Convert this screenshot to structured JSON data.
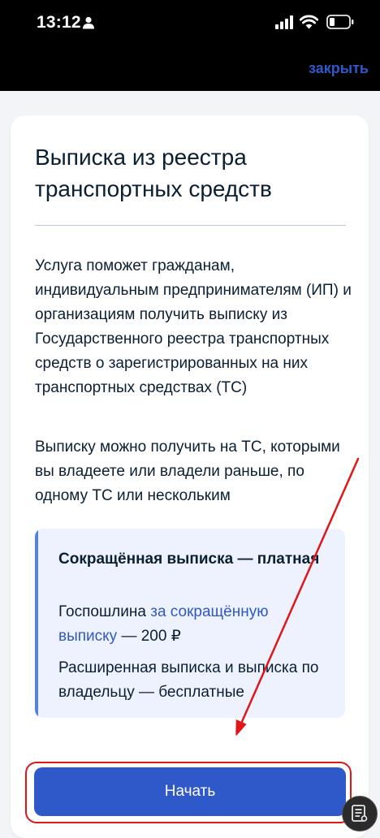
{
  "status_bar": {
    "time": "13:12"
  },
  "header": {
    "close_label": "закрыть"
  },
  "card": {
    "title": "Выписка из реестра транспортных средств",
    "description_1": "Услуга поможет гражданам, индивидуальным предпринимателям (ИП) и организациям получить выписку из Государственного реестра транспортных средств о зарегистрированных на них транспортных средствах (ТС)",
    "description_2": "Выписку можно получить на ТС, которыми вы владеете или владели раньше, по одному ТС или нескольким",
    "info_box": {
      "title": "Сокращённая выписка — платная",
      "fee_prefix": "Госпошлина ",
      "fee_link": "за сокращённую выписку",
      "fee_suffix": " — 200 ₽",
      "free_note": "Расширенная выписка и выписка по владельцу — бесплатные"
    },
    "start_button_label": "Начать"
  },
  "colors": {
    "primary": "#2f58c9",
    "annotation": "#e0161b",
    "text": "#0b1f33",
    "info_bg": "#edf2fe",
    "info_accent": "#5080e8"
  },
  "icons": [
    "person-icon",
    "signal-icon",
    "wifi-icon",
    "battery-icon",
    "document-icon"
  ]
}
